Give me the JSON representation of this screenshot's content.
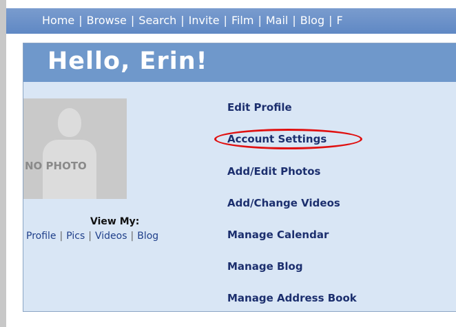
{
  "nav": {
    "items": [
      "Home",
      "Browse",
      "Search",
      "Invite",
      "Film",
      "Mail",
      "Blog",
      "F"
    ]
  },
  "colors": {
    "nav_bg": "#6f94c8",
    "panel_bg": "#d9e6f5",
    "header_bg": "#6f98cb",
    "link": "#1c2f6e",
    "highlight": "#e01010"
  },
  "greeting": "Hello, Erin!",
  "photo": {
    "placeholder_text": "NO PHOTO"
  },
  "view_my": {
    "label": "View My:",
    "links": [
      "Profile",
      "Pics",
      "Videos",
      "Blog"
    ],
    "separator": "|"
  },
  "menu": {
    "items": [
      "Edit Profile",
      "Account Settings",
      "Add/Edit Photos",
      "Add/Change Videos",
      "Manage Calendar",
      "Manage Blog",
      "Manage Address Book"
    ],
    "highlighted": "Account Settings"
  }
}
